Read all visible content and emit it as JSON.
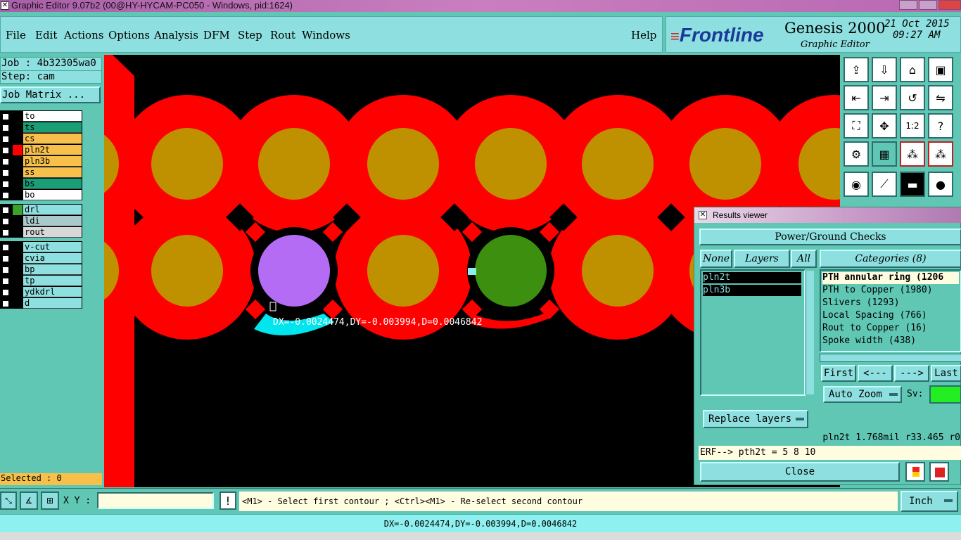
{
  "window": {
    "title": "Graphic Editor 9.07b2 (00@HY-HYCAM-PC050 - Windows, pid:1624)"
  },
  "menu": [
    "File",
    "Edit",
    "Actions",
    "Options",
    "Analysis",
    "DFM",
    "Step",
    "Rout",
    "Windows"
  ],
  "help_label": "Help",
  "logo": {
    "brand": "Frontline",
    "product": "Genesis 2000",
    "subtitle": "Graphic Editor",
    "date": "21 Oct 2015",
    "time": "09:27 AM"
  },
  "job": {
    "job_label": "Job : 4b32305wa0",
    "step_label": "Step: cam",
    "matrix_button": "Job Matrix ...",
    "selected": "Selected : 0"
  },
  "layers": {
    "group1": [
      {
        "name": "to",
        "bg": "#ffffff",
        "swatch": "#000000"
      },
      {
        "name": "ts",
        "bg": "#1a9e76",
        "swatch": "#000000"
      },
      {
        "name": "cs",
        "bg": "#f6c04a",
        "swatch": "#000000"
      },
      {
        "name": "pln2t",
        "bg": "#f6c04a",
        "swatch": "#ff0000"
      },
      {
        "name": "pln3b",
        "bg": "#f6c04a",
        "swatch": "#000000"
      },
      {
        "name": "ss",
        "bg": "#f6c04a",
        "swatch": "#000000"
      },
      {
        "name": "bs",
        "bg": "#1a9e76",
        "swatch": "#000000"
      },
      {
        "name": "bo",
        "bg": "#ffffff",
        "swatch": "#000000"
      }
    ],
    "group2": [
      {
        "name": "drl",
        "bg": "#8edfdf",
        "swatch": "#3da02e"
      },
      {
        "name": "ldi",
        "bg": "#a9c9cc",
        "swatch": "#000000"
      },
      {
        "name": "rout",
        "bg": "#d8d8d8",
        "swatch": "#000000"
      }
    ],
    "group3": [
      {
        "name": "v-cut",
        "bg": "#8edfdf",
        "swatch": "#000000"
      },
      {
        "name": "cvia",
        "bg": "#8edfdf",
        "swatch": "#000000"
      },
      {
        "name": "bp",
        "bg": "#8edfdf",
        "swatch": "#000000"
      },
      {
        "name": "tp",
        "bg": "#8edfdf",
        "swatch": "#000000"
      },
      {
        "name": "ydkdrl",
        "bg": "#8edfdf",
        "swatch": "#000000"
      },
      {
        "name": "d",
        "bg": "#8edfdf",
        "swatch": "#000000"
      }
    ]
  },
  "canvas": {
    "measure_text": "DX=-0.0024474,DY=-0.003994,D=0.0046842"
  },
  "results": {
    "title": "Results viewer",
    "heading": "Power/Ground Checks",
    "none_btn": "None",
    "layers_label": "Layers",
    "all_btn": "All",
    "categories_label": "Categories (8)",
    "layer_list": [
      "pln2t",
      "pln3b"
    ],
    "categories": [
      "PTH annular ring (1206",
      "PTH to Copper (1980)",
      "Slivers (1293)",
      "Local Spacing (766)",
      "Rout to Copper (16)",
      "Spoke width (438)"
    ],
    "first_btn": "First",
    "prev_btn": "<---",
    "next_btn": "--->",
    "last_btn": "Last",
    "zoom_option": "Auto Zoom",
    "sv_label": "Sv:",
    "replace_btn": "Replace layers",
    "info_line": "pln2t 1.768mil  r33.465  r0",
    "erf_line": "ERF--> pth2t = 5 8 10",
    "close_btn": "Close"
  },
  "bottom": {
    "xy_label": "X Y :",
    "xy_value": "",
    "prompt": "<M1> - Select first contour ; <Ctrl><M1> - Re-select second contour",
    "units": "Inch"
  },
  "status": "DX=-0.0024474,DY=-0.003994,D=0.0046842"
}
